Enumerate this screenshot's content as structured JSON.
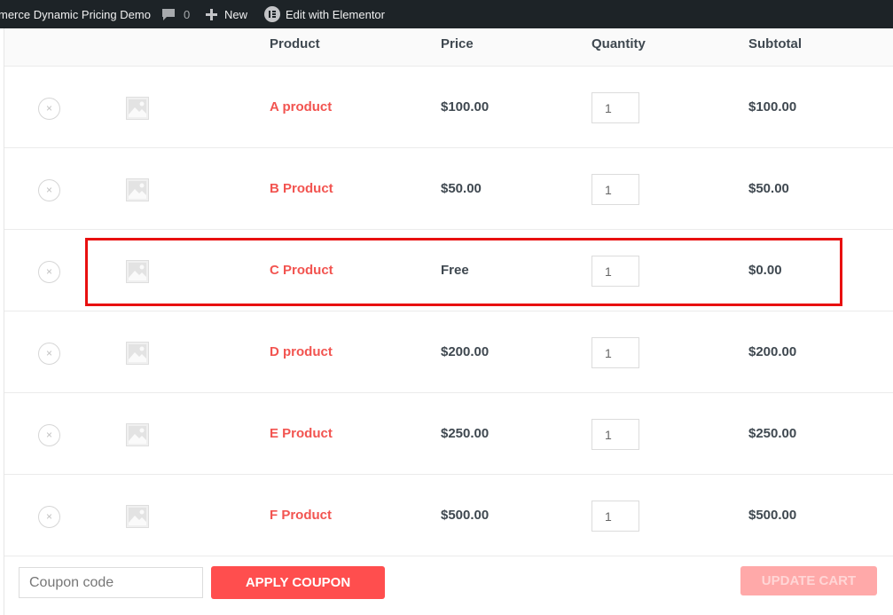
{
  "adminbar": {
    "site_name": "merce Dynamic Pricing Demo",
    "comments_count": "0",
    "new_label": "New",
    "elementor_label": "Edit with Elementor"
  },
  "table": {
    "headers": {
      "product": "Product",
      "price": "Price",
      "quantity": "Quantity",
      "subtotal": "Subtotal"
    },
    "rows": [
      {
        "name": "A product",
        "price": "$100.00",
        "qty": "1",
        "subtotal": "$100.00"
      },
      {
        "name": "B Product",
        "price": "$50.00",
        "qty": "1",
        "subtotal": "$50.00"
      },
      {
        "name": "C Product",
        "price": "Free",
        "qty": "1",
        "subtotal": "$0.00"
      },
      {
        "name": "D product",
        "price": "$200.00",
        "qty": "1",
        "subtotal": "$200.00"
      },
      {
        "name": "E Product",
        "price": "$250.00",
        "qty": "1",
        "subtotal": "$250.00"
      },
      {
        "name": "F Product",
        "price": "$500.00",
        "qty": "1",
        "subtotal": "$500.00"
      }
    ],
    "remove_glyph": "×"
  },
  "actions": {
    "coupon_placeholder": "Coupon code",
    "apply_label": "APPLY COUPON",
    "update_label": "UPDATE CART"
  },
  "colors": {
    "accent": "#ff4e4e",
    "product_link": "#f25450",
    "highlight_border": "#e81010",
    "adminbar_bg": "#1d2327"
  }
}
